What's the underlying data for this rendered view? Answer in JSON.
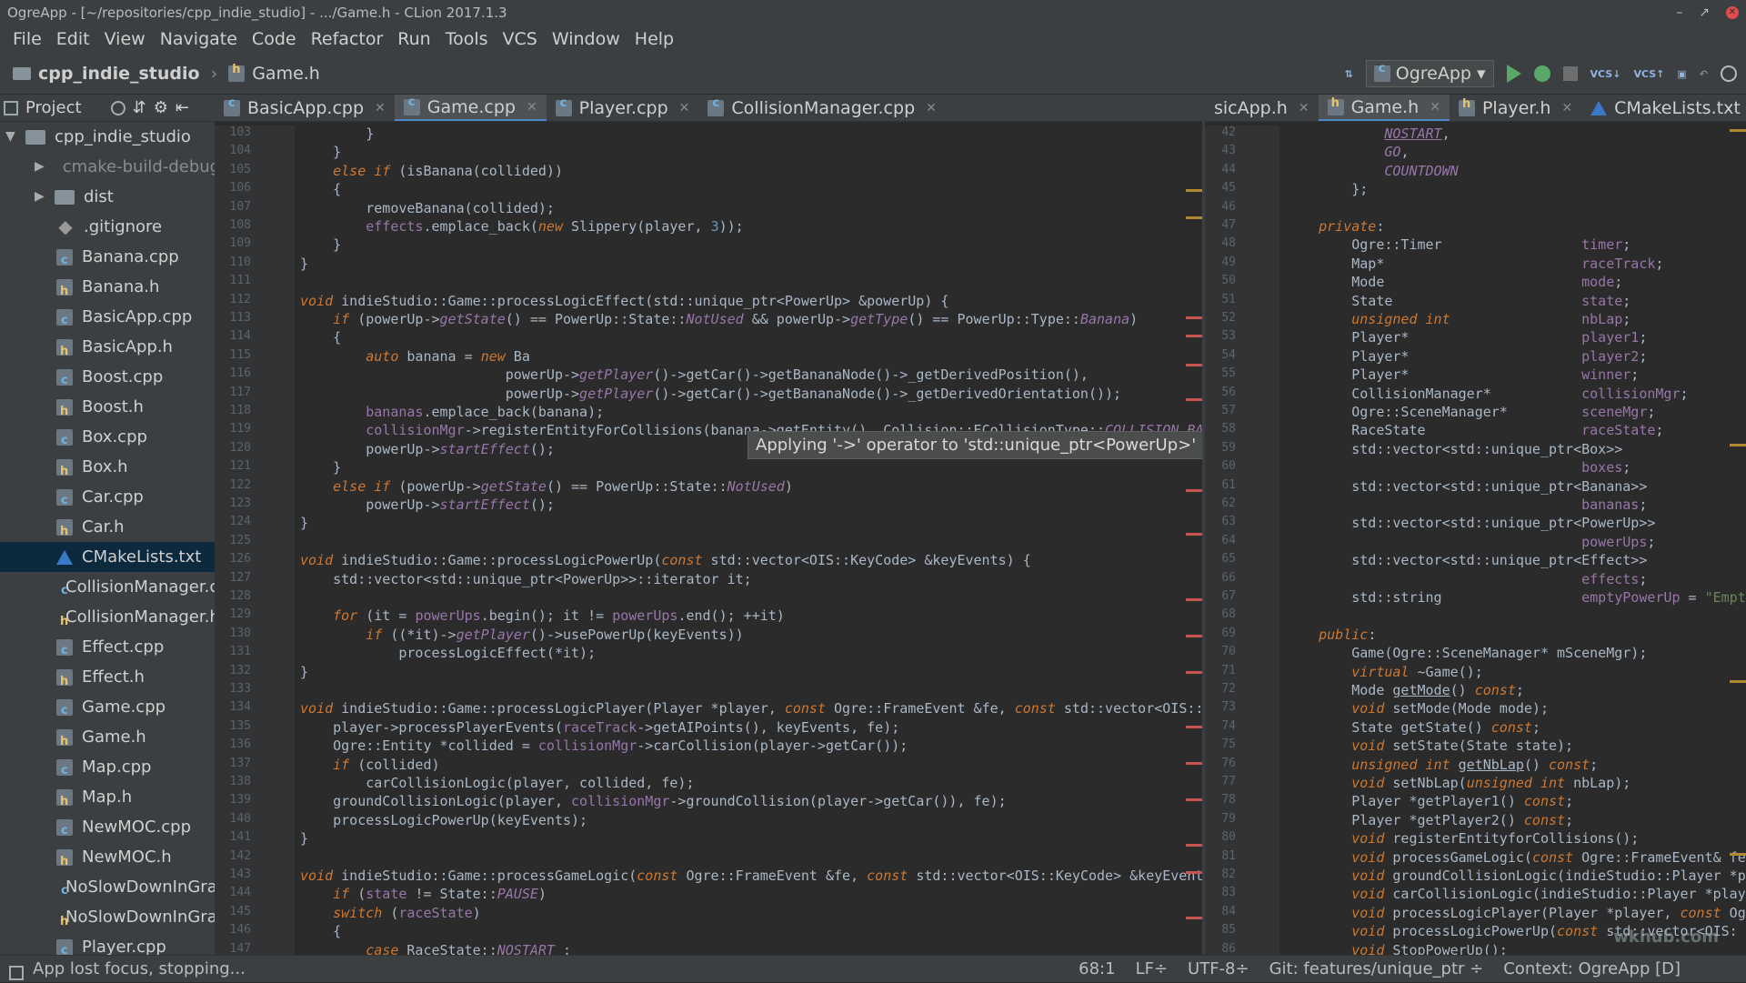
{
  "window": {
    "title": "OgreApp - [~/repositories/cpp_indie_studio] - .../Game.h - CLion 2017.1.3"
  },
  "menu": [
    "File",
    "Edit",
    "View",
    "Navigate",
    "Code",
    "Refactor",
    "Run",
    "Tools",
    "VCS",
    "Window",
    "Help"
  ],
  "breadcrumb": {
    "project": "cpp_indie_studio",
    "file": "Game.h"
  },
  "toolbar": {
    "run_config": "OgreApp"
  },
  "project_panel": {
    "title": "Project",
    "root": "cpp_indie_studio",
    "items": [
      {
        "label": "cmake-build-debug",
        "type": "folder-orange",
        "dim": true
      },
      {
        "label": "dist",
        "type": "folder"
      },
      {
        "label": ".gitignore",
        "type": "git"
      },
      {
        "label": "Banana.cpp",
        "type": "cpp"
      },
      {
        "label": "Banana.h",
        "type": "h"
      },
      {
        "label": "BasicApp.cpp",
        "type": "cpp"
      },
      {
        "label": "BasicApp.h",
        "type": "h"
      },
      {
        "label": "Boost.cpp",
        "type": "cpp"
      },
      {
        "label": "Boost.h",
        "type": "h"
      },
      {
        "label": "Box.cpp",
        "type": "cpp"
      },
      {
        "label": "Box.h",
        "type": "h"
      },
      {
        "label": "Car.cpp",
        "type": "cpp"
      },
      {
        "label": "Car.h",
        "type": "h"
      },
      {
        "label": "CMakeLists.txt",
        "type": "cmake",
        "selected": true
      },
      {
        "label": "CollisionManager.cpp",
        "type": "cpp"
      },
      {
        "label": "CollisionManager.h",
        "type": "h"
      },
      {
        "label": "Effect.cpp",
        "type": "cpp"
      },
      {
        "label": "Effect.h",
        "type": "h"
      },
      {
        "label": "Game.cpp",
        "type": "cpp"
      },
      {
        "label": "Game.h",
        "type": "h"
      },
      {
        "label": "Map.cpp",
        "type": "cpp"
      },
      {
        "label": "Map.h",
        "type": "h"
      },
      {
        "label": "NewMOC.cpp",
        "type": "cpp"
      },
      {
        "label": "NewMOC.h",
        "type": "h"
      },
      {
        "label": "NoSlowDownInGrass.cpp",
        "type": "cpp"
      },
      {
        "label": "NoSlowDownInGrass.h",
        "type": "h"
      },
      {
        "label": "Player.cpp",
        "type": "cpp"
      }
    ]
  },
  "left_tabs": [
    {
      "label": "BasicApp.cpp",
      "icon": "cpp"
    },
    {
      "label": "Game.cpp",
      "icon": "cpp",
      "active": true
    },
    {
      "label": "Player.cpp",
      "icon": "cpp"
    },
    {
      "label": "CollisionManager.cpp",
      "icon": "cpp"
    }
  ],
  "right_tabs": [
    {
      "label": "sicApp.h",
      "icon": "none"
    },
    {
      "label": "Game.h",
      "icon": "h",
      "active": true
    },
    {
      "label": "Player.h",
      "icon": "h"
    },
    {
      "label": "CMakeLists.txt",
      "icon": "cmake"
    }
  ],
  "left_code": [
    {
      "n": "103",
      "h": "        }"
    },
    {
      "n": "104",
      "h": "    }"
    },
    {
      "n": "105",
      "h": "    <span class=\"kw\">else if</span> (isBanana(collided))"
    },
    {
      "n": "106",
      "h": "    {"
    },
    {
      "n": "107",
      "h": "        removeBanana(collided);"
    },
    {
      "n": "108",
      "h": "        <span class=\"fld\">effects</span>.emplace_back(<span class=\"kw\">new</span> Slippery(player, <span class=\"num\">3</span>));"
    },
    {
      "n": "109",
      "h": "    }"
    },
    {
      "n": "110",
      "h": "}"
    },
    {
      "n": "111",
      "h": ""
    },
    {
      "n": "112",
      "h": "<span class=\"kw\">void</span> indieStudio::Game::processLogicEffect(std::unique_ptr&lt;PowerUp&gt; &amp;powerUp) {"
    },
    {
      "n": "113",
      "h": "    <span class=\"kw\">if</span> (powerUp-&gt;<span class=\"fn\">getState</span>() == PowerUp::State::<span class=\"fn\">NotUsed</span> &amp;&amp; powerUp-&gt;<span class=\"fn\">getType</span>() == PowerUp::Type::<span class=\"fn\">Banana</span>)"
    },
    {
      "n": "114",
      "h": "    {"
    },
    {
      "n": "115",
      "h": "        <span class=\"kw\">auto</span> banana = <span class=\"kw\">new</span> Ba"
    },
    {
      "n": "116",
      "h": "                         powerUp-&gt;<span class=\"fn\">getPlayer</span>()-&gt;getCar()-&gt;getBananaNode()-&gt;_getDerivedPosition(),"
    },
    {
      "n": "117",
      "h": "                         powerUp-&gt;<span class=\"fn\">getPlayer</span>()-&gt;getCar()-&gt;getBananaNode()-&gt;_getDerivedOrientation());"
    },
    {
      "n": "118",
      "h": "        <span class=\"fld\">bananas</span>.emplace_back(banana);"
    },
    {
      "n": "119",
      "h": "        <span class=\"fld\">collisionMgr</span>-&gt;registerEntityForCollisions(banana-&gt;getEntity(), Collision::ECollisionType::<span class=\"fn\">COLLISION_BA</span>"
    },
    {
      "n": "120",
      "h": "        powerUp-&gt;<span class=\"fn\">startEffect</span>();"
    },
    {
      "n": "121",
      "h": "    }"
    },
    {
      "n": "122",
      "h": "    <span class=\"kw\">else if</span> (powerUp-&gt;<span class=\"fn\">getState</span>() == PowerUp::State::<span class=\"fn\">NotUsed</span>)"
    },
    {
      "n": "123",
      "h": "        powerUp-&gt;<span class=\"fn\">startEffect</span>();"
    },
    {
      "n": "124",
      "h": "}"
    },
    {
      "n": "125",
      "h": ""
    },
    {
      "n": "126",
      "h": "<span class=\"kw\">void</span> indieStudio::Game::processLogicPowerUp(<span class=\"kw\">const</span> std::vector&lt;OIS::KeyCode&gt; &amp;keyEvents) {"
    },
    {
      "n": "127",
      "h": "    std::vector&lt;std::unique_ptr&lt;PowerUp&gt;&gt;::iterator it;"
    },
    {
      "n": "128",
      "h": ""
    },
    {
      "n": "129",
      "h": "    <span class=\"kw\">for</span> (it = <span class=\"fld\">powerUps</span>.begin(); it != <span class=\"fld\">powerUps</span>.end(); ++it)"
    },
    {
      "n": "130",
      "h": "        <span class=\"kw\">if</span> ((*it)-&gt;<span class=\"fn\">getPlayer</span>()-&gt;usePowerUp(keyEvents))"
    },
    {
      "n": "131",
      "h": "            processLogicEffect(*it);"
    },
    {
      "n": "132",
      "h": "}"
    },
    {
      "n": "133",
      "h": ""
    },
    {
      "n": "134",
      "h": "<span class=\"kw\">void</span> indieStudio::Game::processLogicPlayer(Player *player, <span class=\"kw\">const</span> Ogre::FrameEvent &amp;fe, <span class=\"kw\">const</span> std::vector&lt;OIS::K"
    },
    {
      "n": "135",
      "h": "    player-&gt;processPlayerEvents(<span class=\"fld\">raceTrack</span>-&gt;getAIPoints(), keyEvents, fe);"
    },
    {
      "n": "136",
      "h": "    Ogre::Entity *collided = <span class=\"fld\">collisionMgr</span>-&gt;carCollision(player-&gt;getCar());"
    },
    {
      "n": "137",
      "h": "    <span class=\"kw\">if</span> (collided)"
    },
    {
      "n": "138",
      "h": "        carCollisionLogic(player, collided, fe);"
    },
    {
      "n": "139",
      "h": "    groundCollisionLogic(player, <span class=\"fld\">collisionMgr</span>-&gt;groundCollision(player-&gt;getCar()), fe);"
    },
    {
      "n": "140",
      "h": "    processLogicPowerUp(keyEvents);"
    },
    {
      "n": "141",
      "h": "}"
    },
    {
      "n": "142",
      "h": ""
    },
    {
      "n": "143",
      "h": "<span class=\"kw\">void</span> indieStudio::Game::processGameLogic(<span class=\"kw\">const</span> Ogre::FrameEvent &amp;fe, <span class=\"kw\">const</span> std::vector&lt;OIS::KeyCode&gt; &amp;keyEvents"
    },
    {
      "n": "144",
      "h": "    <span class=\"kw\">if</span> (<span class=\"fld\">state</span> != State::<span class=\"fn\">PAUSE</span>)"
    },
    {
      "n": "145",
      "h": "    <span class=\"kw\">switch</span> (<span class=\"fld\">raceState</span>)"
    },
    {
      "n": "146",
      "h": "    {"
    },
    {
      "n": "147",
      "h": "        <span class=\"kw\">case</span> RaceState::<span class=\"fn\">NOSTART</span> :"
    }
  ],
  "right_code": [
    {
      "n": "42",
      "h": "            <span class=\"fn\" style=\"text-decoration:underline\">NOSTART</span>,"
    },
    {
      "n": "43",
      "h": "            <span class=\"fn\">GO</span>,"
    },
    {
      "n": "44",
      "h": "            <span class=\"fn\">COUNTDOWN</span>"
    },
    {
      "n": "45",
      "h": "        };"
    },
    {
      "n": "46",
      "h": ""
    },
    {
      "n": "47",
      "h": "    <span class=\"kw\">private</span>:"
    },
    {
      "n": "48",
      "h": "        Ogre::Timer                 <span class=\"fld\">timer</span>;"
    },
    {
      "n": "49",
      "h": "        Map*                        <span class=\"fld\">raceTrack</span>;"
    },
    {
      "n": "50",
      "h": "        Mode                        <span class=\"fld\">mode</span>;"
    },
    {
      "n": "51",
      "h": "        State                       <span class=\"fld\">state</span>;"
    },
    {
      "n": "52",
      "h": "        <span class=\"kw\">unsigned int</span>                <span class=\"fld\">nbLap</span>;"
    },
    {
      "n": "53",
      "h": "        Player*                     <span class=\"fld\">player1</span>;"
    },
    {
      "n": "54",
      "h": "        Player*                     <span class=\"fld\">player2</span>;"
    },
    {
      "n": "55",
      "h": "        Player*                     <span class=\"fld\">winner</span>;"
    },
    {
      "n": "56",
      "h": "        CollisionManager*           <span class=\"fld\">collisionMgr</span>;"
    },
    {
      "n": "57",
      "h": "        Ogre::SceneManager*         <span class=\"fld\">sceneMgr</span>;"
    },
    {
      "n": "58",
      "h": "        RaceState                   <span class=\"fld\">raceState</span>;"
    },
    {
      "n": "59",
      "h": "        std::vector&lt;std::unique_ptr&lt;Box&gt;&gt;"
    },
    {
      "n": "60",
      "h": "                                    <span class=\"fld\">boxes</span>;"
    },
    {
      "n": "61",
      "h": "        std::vector&lt;std::unique_ptr&lt;Banana&gt;&gt;"
    },
    {
      "n": "62",
      "h": "                                    <span class=\"fld\">bananas</span>;"
    },
    {
      "n": "63",
      "h": "        std::vector&lt;std::unique_ptr&lt;PowerUp&gt;&gt;"
    },
    {
      "n": "64",
      "h": "                                    <span class=\"fld\">powerUps</span>;"
    },
    {
      "n": "65",
      "h": "        std::vector&lt;std::unique_ptr&lt;Effect&gt;&gt;"
    },
    {
      "n": "66",
      "h": "                                    <span class=\"fld\">effects</span>;"
    },
    {
      "n": "67",
      "h": "        std::string                 <span class=\"fld\">emptyPowerUp</span> = <span style=\"color:#6a8759\">\"Empt</span>"
    },
    {
      "n": "68",
      "h": ""
    },
    {
      "n": "69",
      "h": "    <span class=\"kw\">public</span>:"
    },
    {
      "n": "70",
      "h": "        Game(Ogre::SceneManager* mSceneMgr);"
    },
    {
      "n": "71",
      "h": "        <span class=\"kw\">virtual</span> ~Game();"
    },
    {
      "n": "72",
      "h": "        Mode <span style=\"text-decoration:underline\">getMode</span>() <span class=\"kw\">const</span>;"
    },
    {
      "n": "73",
      "h": "        <span class=\"kw\">void</span> setMode(Mode mode);"
    },
    {
      "n": "74",
      "h": "        State getState() <span class=\"kw\">const</span>;"
    },
    {
      "n": "75",
      "h": "        <span class=\"kw\">void</span> setState(State state);"
    },
    {
      "n": "76",
      "h": "        <span class=\"kw\">unsigned int</span> <span style=\"text-decoration:underline\">getNbLap</span>() <span class=\"kw\">const</span>;"
    },
    {
      "n": "77",
      "h": "        <span class=\"kw\">void</span> setNbLap(<span class=\"kw\">unsigned int</span> nbLap);"
    },
    {
      "n": "78",
      "h": "        Player *getPlayer1() <span class=\"kw\">const</span>;"
    },
    {
      "n": "79",
      "h": "        Player *getPlayer2() <span class=\"kw\">const</span>;"
    },
    {
      "n": "80",
      "h": "        <span class=\"kw\">void</span> registerEntityforCollisions();"
    },
    {
      "n": "81",
      "h": "        <span class=\"kw\">void</span> processGameLogic(<span class=\"kw\">const</span> Ogre::FrameEvent&amp; fe"
    },
    {
      "n": "82",
      "h": "        <span class=\"kw\">void</span> groundCollisionLogic(indieStudio::Player *p"
    },
    {
      "n": "83",
      "h": "        <span class=\"kw\">void</span> carCollisionLogic(indieStudio::Player *play"
    },
    {
      "n": "84",
      "h": "        <span class=\"kw\">void</span> processLogicPlayer(Player *player, <span class=\"kw\">const</span> Og"
    },
    {
      "n": "85",
      "h": "        <span class=\"kw\">void</span> processLogicPowerUp(<span class=\"kw\">const</span> std::vector&lt;OIS:"
    },
    {
      "n": "86",
      "h": "        <span class=\"kw\">void</span> StopPowerUp();"
    }
  ],
  "tooltip": "Applying '->' operator to 'std::unique_ptr<PowerUp>' instead of a pointer",
  "status": {
    "message": "App lost focus, stopping...",
    "position": "68:1",
    "line_sep": "LF÷",
    "encoding": "UTF-8÷",
    "git": "Git: features/unique_ptr ÷",
    "context": "Context: OgreApp [D]"
  },
  "watermark": "wkhub.com"
}
